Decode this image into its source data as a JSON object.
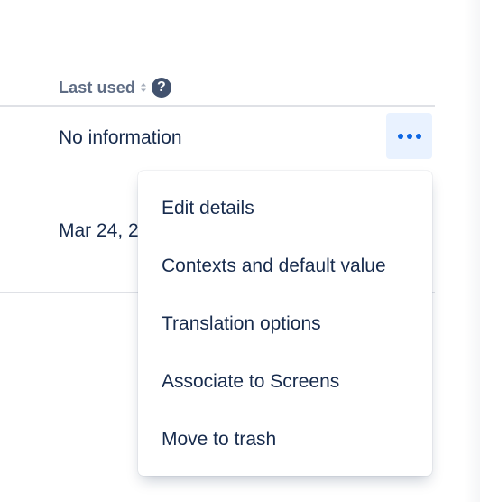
{
  "table": {
    "column_header": "Last used",
    "rows": [
      {
        "last_used": "No information"
      },
      {
        "last_used": "Mar 24, 2"
      }
    ]
  },
  "menu": {
    "items": [
      {
        "label": "Edit details"
      },
      {
        "label": "Contexts and default value"
      },
      {
        "label": "Translation options"
      },
      {
        "label": "Associate to Screens"
      },
      {
        "label": "Move to trash"
      }
    ]
  },
  "icons": {
    "sort": "sort-icon",
    "help": "question-circle-icon",
    "more": "more-horizontal-icon"
  },
  "help_glyph": "?",
  "colors": {
    "accent": "#0c66e4",
    "accent_bg": "#e9f2ff",
    "text": "#172b4d",
    "header_text": "#5e6c84",
    "divider": "#dfe1e6"
  }
}
